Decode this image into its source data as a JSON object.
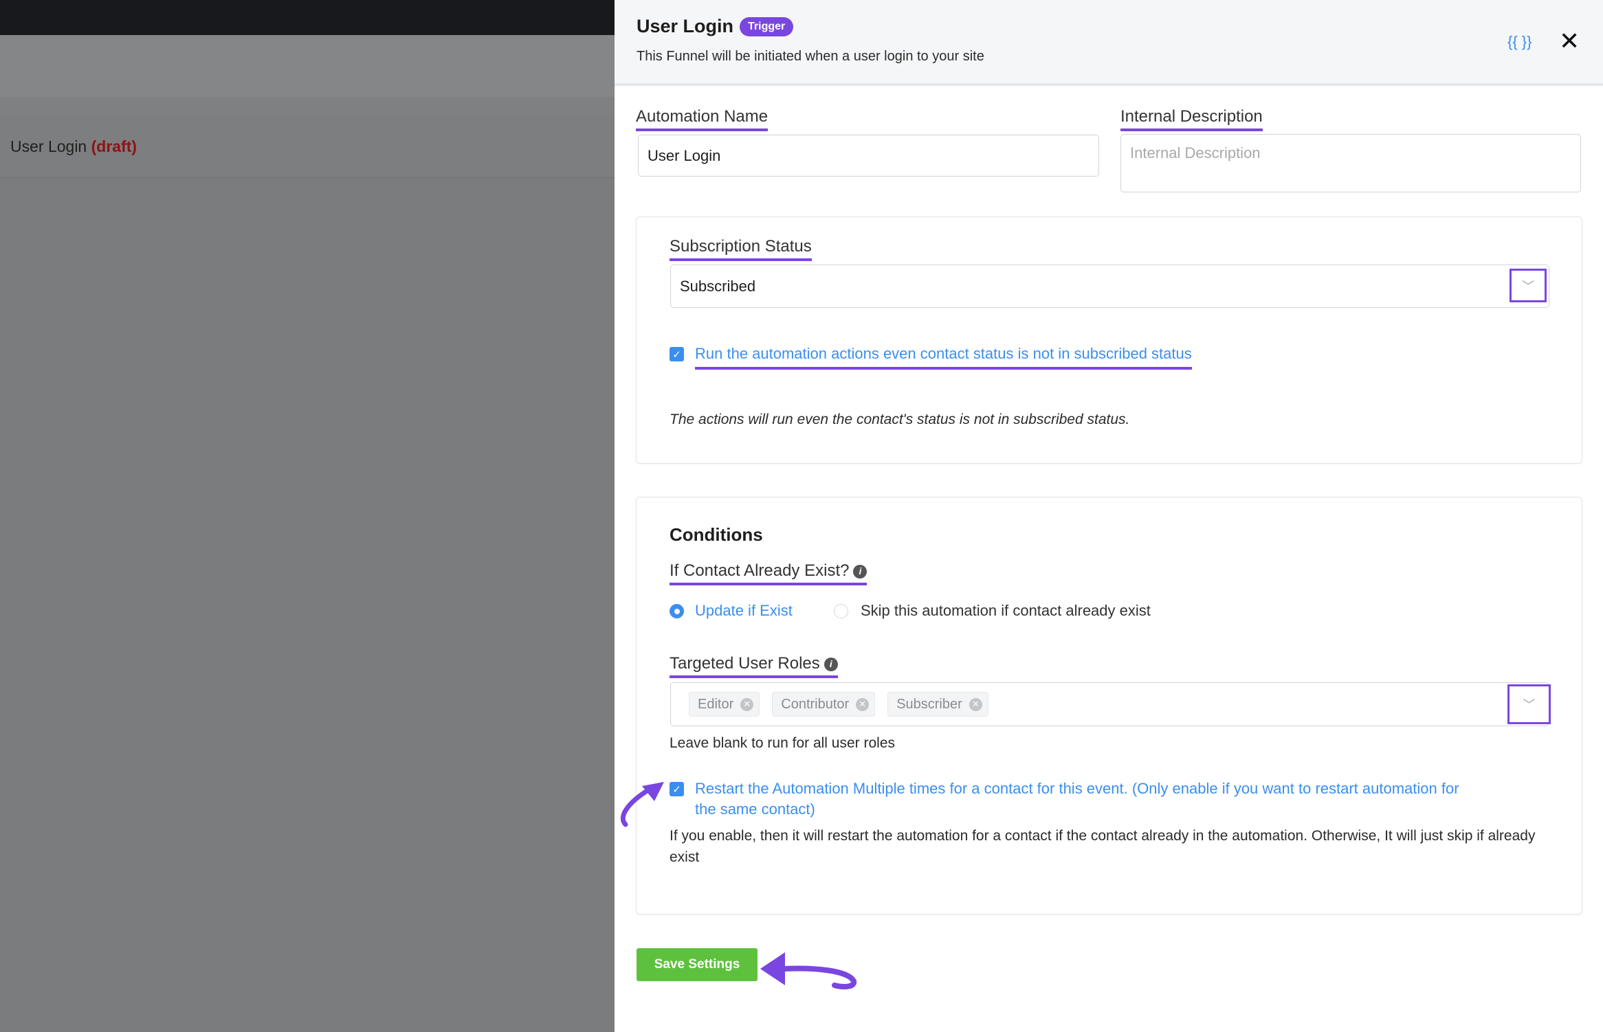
{
  "background": {
    "title": "User Login",
    "status": "(draft)"
  },
  "header": {
    "title": "User Login",
    "badge": "Trigger",
    "subtitle": "This Funnel will be initiated when a user login to your site",
    "braces_icon": "{{ }}",
    "close_icon": "✕"
  },
  "automation_name": {
    "label": "Automation Name",
    "value": "User Login"
  },
  "internal_description": {
    "label": "Internal Description",
    "placeholder": "Internal Description"
  },
  "subscription": {
    "label": "Subscription Status",
    "value": "Subscribed",
    "checkbox_label": "Run the automation actions even contact status is not in subscribed status",
    "checked": true,
    "note": "The actions will run even the contact's status is not in subscribed status."
  },
  "conditions": {
    "title": "Conditions",
    "contact_exist_label": "If Contact Already Exist?",
    "options": [
      {
        "label": "Update if Exist",
        "selected": true
      },
      {
        "label": "Skip this automation if contact already exist",
        "selected": false
      }
    ],
    "roles_label": "Targeted User Roles",
    "roles": [
      "Editor",
      "Contributor",
      "Subscriber"
    ],
    "roles_help": "Leave blank to run for all user roles",
    "restart_label": "Restart the Automation Multiple times for a contact for this event. (Only enable if you want to restart automation for the same contact)",
    "restart_checked": true,
    "restart_help": "If you enable, then it will restart the automation for a contact if the contact already in the automation. Otherwise, It will just skip if already exist"
  },
  "save_label": "Save Settings",
  "colors": {
    "accent": "#7a46e0",
    "link": "#3a8ef0",
    "save": "#5ec13d"
  }
}
